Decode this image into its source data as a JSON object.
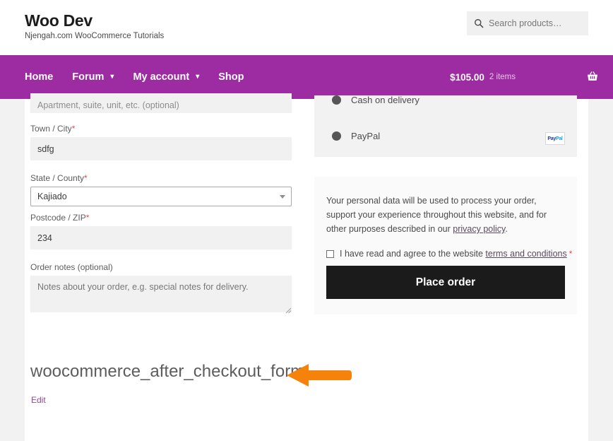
{
  "header": {
    "brand_title": "Woo Dev",
    "brand_tagline": "Njengah.com WooCommerce Tutorials",
    "search": {
      "icon": "search-icon",
      "placeholder": "Search products…",
      "value": ""
    }
  },
  "nav": {
    "items": [
      {
        "label": "Home",
        "has_caret": false
      },
      {
        "label": "Forum",
        "has_caret": true,
        "caret": "▾"
      },
      {
        "label": "My account",
        "has_caret": true,
        "caret": "▾"
      },
      {
        "label": "Shop",
        "has_caret": false
      }
    ],
    "cart": {
      "total": "$105.00",
      "count": "2 items",
      "icon": "shopping-basket-icon"
    },
    "background_color": "#9d2ca3"
  },
  "checkout": {
    "billing": {
      "fields": [
        {
          "id": "apartment",
          "label": "",
          "required": false,
          "type": "text",
          "value": "",
          "placeholder": "Apartment, suite, unit, etc. (optional)",
          "clipped": true
        },
        {
          "id": "city",
          "label": "Town / City",
          "required": true,
          "type": "text",
          "value": "sdfg",
          "placeholder": ""
        },
        {
          "id": "state",
          "label": "State / County",
          "required": true,
          "type": "select",
          "value": "Kajiado",
          "placeholder": ""
        },
        {
          "id": "postcode",
          "label": "Postcode / ZIP",
          "required": true,
          "type": "text",
          "value": "234",
          "placeholder": ""
        },
        {
          "id": "order-notes",
          "label": "Order notes (optional)",
          "required": false,
          "type": "textarea",
          "value": "",
          "placeholder": "Notes about your order, e.g. special notes for delivery."
        }
      ],
      "required_marker": "*"
    },
    "payment": {
      "methods": [
        {
          "id": "cod",
          "label": "Cash on delivery",
          "selected": true,
          "logo": ""
        },
        {
          "id": "paypal",
          "label": "PayPal",
          "selected": false,
          "logo": "paypal-logo"
        }
      ],
      "paypal_logo_parts": {
        "first": "Pay",
        "second": "Pal"
      }
    },
    "privacy": {
      "text_before": "Your personal data will be used to process your order, support your experience throughout this website, and for other purposes described in our ",
      "link": "privacy policy",
      "text_after": "."
    },
    "terms": {
      "checked": false,
      "text_before": "I have read and agree to the website ",
      "link": "terms and conditions",
      "required_marker": "*"
    },
    "place_order_label": "Place order"
  },
  "hook": {
    "title": "woocommerce_after_checkout_form",
    "edit_label": "Edit",
    "arrow": {
      "name": "left-arrow-annotation",
      "color": "#f5820b",
      "direction": "left"
    }
  }
}
